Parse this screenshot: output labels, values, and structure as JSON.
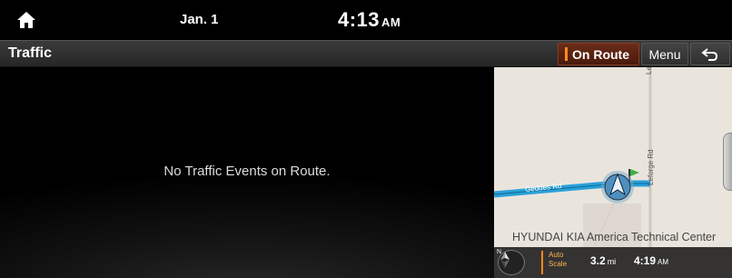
{
  "status": {
    "date": "Jan. 1",
    "time": "4:13",
    "ampm": "AM"
  },
  "header": {
    "title": "Traffic",
    "on_route_label": "On Route",
    "menu_label": "Menu"
  },
  "main": {
    "message": "No Traffic Events on Route."
  },
  "map": {
    "road_vertical": "Leforge Rd",
    "road_vertical_2": "Leforge Rd",
    "road_horizontal": "Geddes Rd",
    "poi_label": "HYUNDAI KIA America Technical Center",
    "auto_scale": "Auto Scale",
    "distance_value": "3.2",
    "distance_unit": "mi",
    "eta_time": "4:19",
    "eta_ampm": "AM",
    "compass_label": "N"
  },
  "colors": {
    "accent": "#ff8a1e",
    "route": "#2aa0d8"
  },
  "icons": {
    "home": "home-icon",
    "back": "back-arrow-icon",
    "compass": "compass-icon",
    "vehicle": "vehicle-position-icon",
    "destination": "destination-flag-icon"
  }
}
